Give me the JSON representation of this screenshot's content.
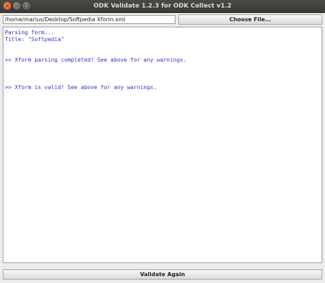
{
  "window": {
    "title": "ODK Validate 1.2.3 for ODK Collect v1.2",
    "close_glyph": "×",
    "minimize_glyph": "–",
    "maximize_glyph": "□"
  },
  "file": {
    "path": "/home/marius/Desktop/Softpedia Xform.xml",
    "choose_label": "Choose File..."
  },
  "output": {
    "lines": [
      "Parsing form...",
      "Title: \"Softpedia\"",
      "",
      "",
      ">> Xform parsing completed! See above for any warnings.",
      "",
      "",
      "",
      ">> Xform is valid! See above for any warnings."
    ]
  },
  "actions": {
    "validate_label": "Validate Again"
  },
  "colors": {
    "output_text": "#2a35c8",
    "titlebar": "#3c3b37",
    "close_button": "#e95420"
  }
}
